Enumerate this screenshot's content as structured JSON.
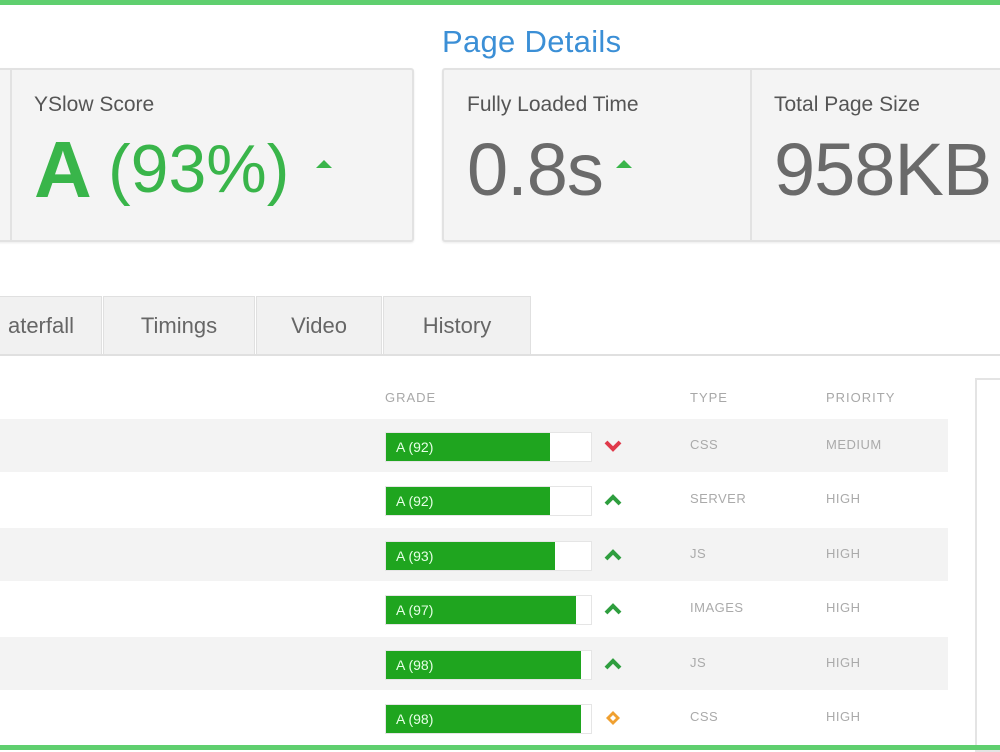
{
  "header": {
    "title": "Page Details"
  },
  "yslow": {
    "label": "YSlow Score",
    "grade": "A",
    "percent": "(93%)"
  },
  "metrics": [
    {
      "label": "Fully Loaded Time",
      "value": "0.8s"
    },
    {
      "label": "Total Page Size",
      "value": "958KB"
    }
  ],
  "tabs": [
    {
      "label": "aterfall"
    },
    {
      "label": "Timings"
    },
    {
      "label": "Video"
    },
    {
      "label": "History"
    }
  ],
  "table": {
    "columns": {
      "grade": "GRADE",
      "type": "TYPE",
      "priority": "PRIORITY"
    },
    "rows": [
      {
        "grade": "A (92)",
        "score": 92,
        "trend": "down",
        "type": "CSS",
        "priority": "MEDIUM"
      },
      {
        "grade": "A (92)",
        "score": 92,
        "trend": "up",
        "type": "SERVER",
        "priority": "HIGH"
      },
      {
        "grade": "A (93)",
        "score": 93,
        "trend": "up",
        "type": "JS",
        "priority": "HIGH"
      },
      {
        "grade": "A (97)",
        "score": 97,
        "trend": "up",
        "type": "IMAGES",
        "priority": "HIGH"
      },
      {
        "grade": "A (98)",
        "score": 98,
        "trend": "up",
        "type": "JS",
        "priority": "HIGH"
      },
      {
        "grade": "A (98)",
        "score": 98,
        "trend": "neutral",
        "type": "CSS",
        "priority": "HIGH"
      }
    ]
  },
  "colors": {
    "accent": "#39b54a",
    "grade_bar": "#1fa51f",
    "title": "#3b8fd6",
    "down": "#e0394a",
    "neutral": "#f0a030"
  }
}
